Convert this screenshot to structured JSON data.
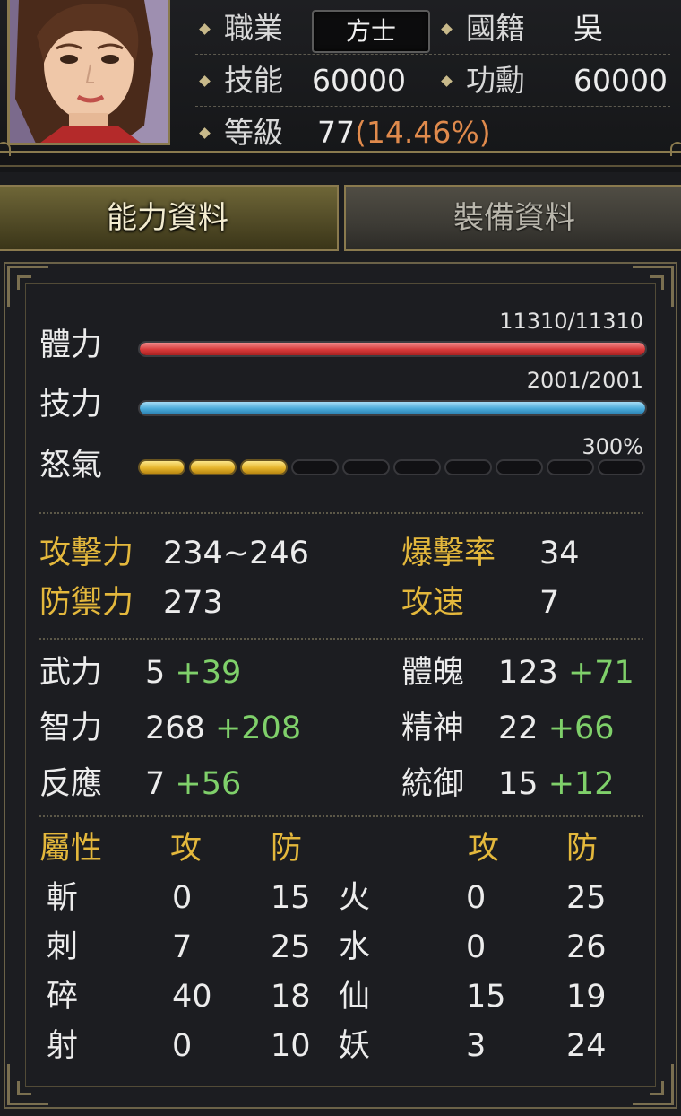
{
  "header": {
    "job_label": "職業",
    "job_value": "方士",
    "nation_label": "國籍",
    "nation_value": "吳",
    "skill_label": "技能",
    "skill_value": "60000",
    "merit_label": "功勳",
    "merit_value": "60000",
    "level_label": "等級",
    "level_value": "77",
    "level_percent": "(14.46%)"
  },
  "tabs": {
    "ability": "能力資料",
    "equipment": "裝備資料",
    "active": "ability"
  },
  "bars": {
    "hp": {
      "label": "體力",
      "value": "11310/11310",
      "fraction": 1.0
    },
    "mp": {
      "label": "技力",
      "value": "2001/2001",
      "fraction": 1.0
    },
    "rage": {
      "label": "怒氣",
      "value": "300%",
      "filled_segments": 3,
      "total_segments": 10
    }
  },
  "combat": {
    "attack_label": "攻擊力",
    "attack_value": "234~246",
    "crit_label": "爆擊率",
    "crit_value": "34",
    "defense_label": "防禦力",
    "defense_value": "273",
    "speed_label": "攻速",
    "speed_value": "7"
  },
  "attributes": [
    {
      "label": "武力",
      "base": "5",
      "bonus": "+39"
    },
    {
      "label": "體魄",
      "base": "123",
      "bonus": "+71"
    },
    {
      "label": "智力",
      "base": "268",
      "bonus": "+208"
    },
    {
      "label": "精神",
      "base": "22",
      "bonus": "+66"
    },
    {
      "label": "反應",
      "base": "7",
      "bonus": "+56"
    },
    {
      "label": "統御",
      "base": "15",
      "bonus": "+12"
    }
  ],
  "elements": {
    "header": {
      "title": "屬性",
      "atk": "攻",
      "def": "防",
      "atk2": "攻",
      "def2": "防"
    },
    "rows": [
      {
        "a": "斬",
        "a_atk": "0",
        "a_def": "15",
        "b": "火",
        "b_atk": "0",
        "b_def": "25"
      },
      {
        "a": "刺",
        "a_atk": "7",
        "a_def": "25",
        "b": "水",
        "b_atk": "0",
        "b_def": "26"
      },
      {
        "a": "碎",
        "a_atk": "40",
        "a_def": "18",
        "b": "仙",
        "b_atk": "15",
        "b_def": "19"
      },
      {
        "a": "射",
        "a_atk": "0",
        "a_def": "10",
        "b": "妖",
        "b_atk": "3",
        "b_def": "24"
      }
    ]
  },
  "colors": {
    "gold_label": "#e4b83c",
    "green_bonus": "#7fd06a",
    "level_percent": "#e08a4c",
    "hp_bar": "#d83a3a",
    "mp_bar": "#4aaad9",
    "rage_bar": "#e6b52c"
  }
}
